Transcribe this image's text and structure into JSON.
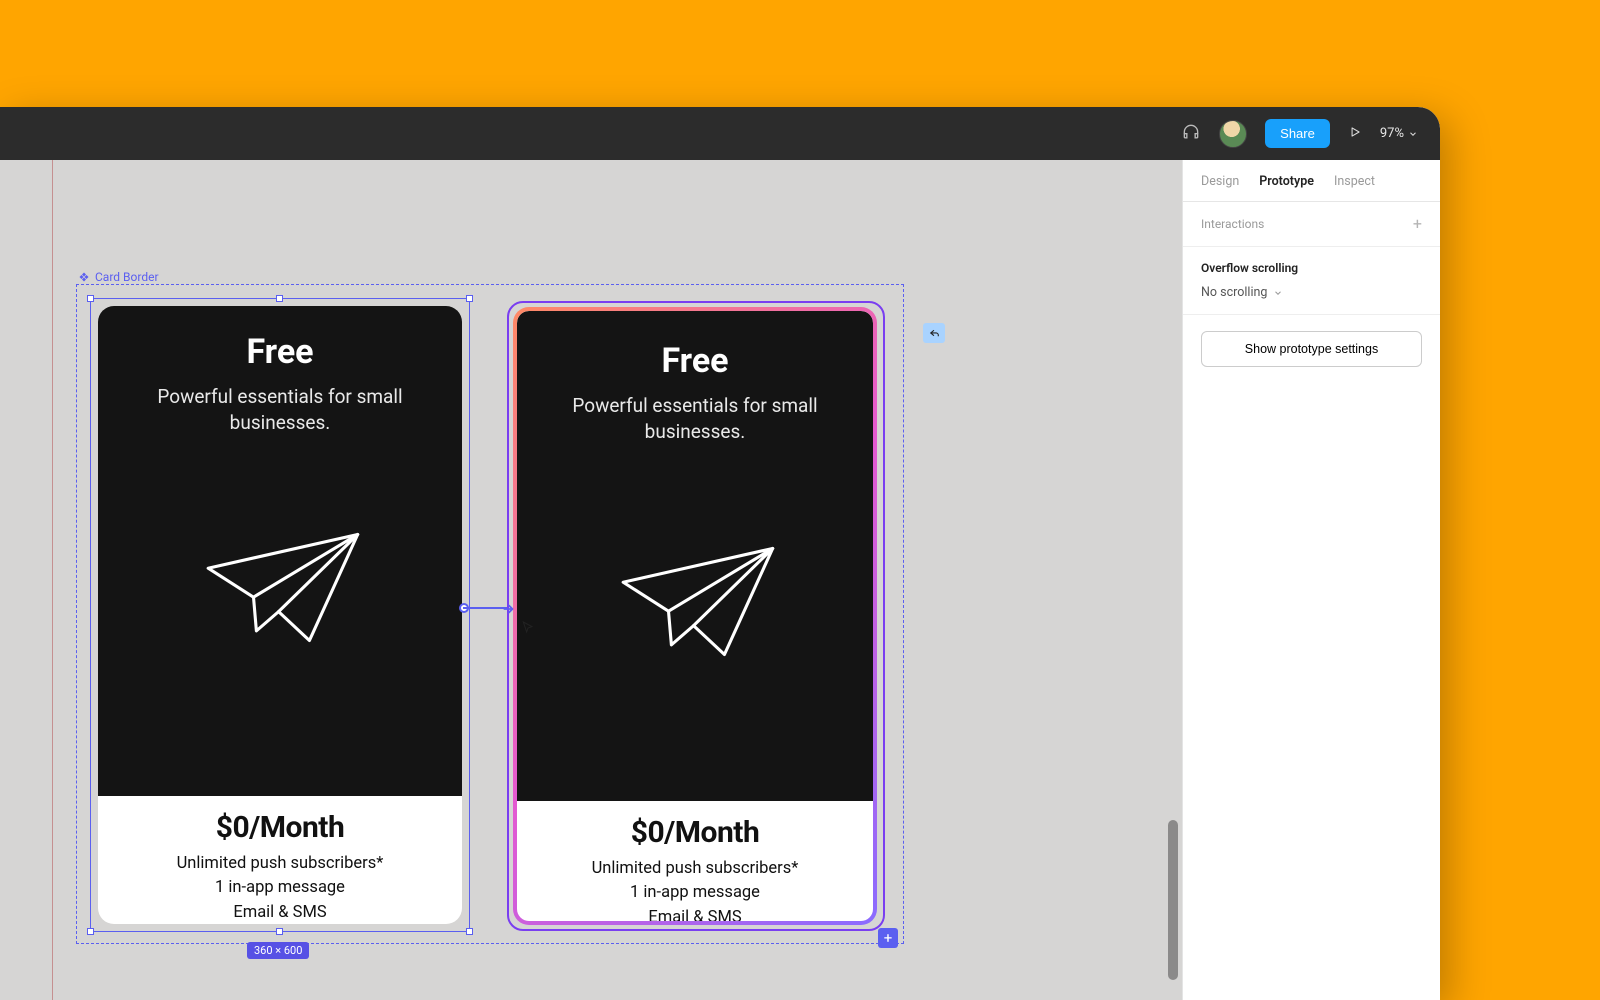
{
  "topbar": {
    "share_label": "Share",
    "zoom_label": "97%"
  },
  "panel": {
    "tabs": {
      "design": "Design",
      "prototype": "Prototype",
      "inspect": "Inspect",
      "active": "prototype"
    },
    "interactions_label": "Interactions",
    "overflow_heading": "Overflow scrolling",
    "overflow_value": "No scrolling",
    "proto_settings_label": "Show prototype settings"
  },
  "canvas": {
    "frame_label": "Card Border",
    "dimensions_label": "360 × 600"
  },
  "card1": {
    "title": "Free",
    "subtitle": "Powerful essentials for small businesses.",
    "price": "$0/Month",
    "feat1": "Unlimited push subscribers*",
    "feat2": "1 in-app message",
    "feat3": "Email & SMS"
  },
  "card2": {
    "title": "Free",
    "subtitle": "Powerful essentials for small businesses.",
    "price": "$0/Month",
    "feat1": "Unlimited push subscribers*",
    "feat2": "1 in-app message",
    "feat3": "Email & SMS"
  }
}
